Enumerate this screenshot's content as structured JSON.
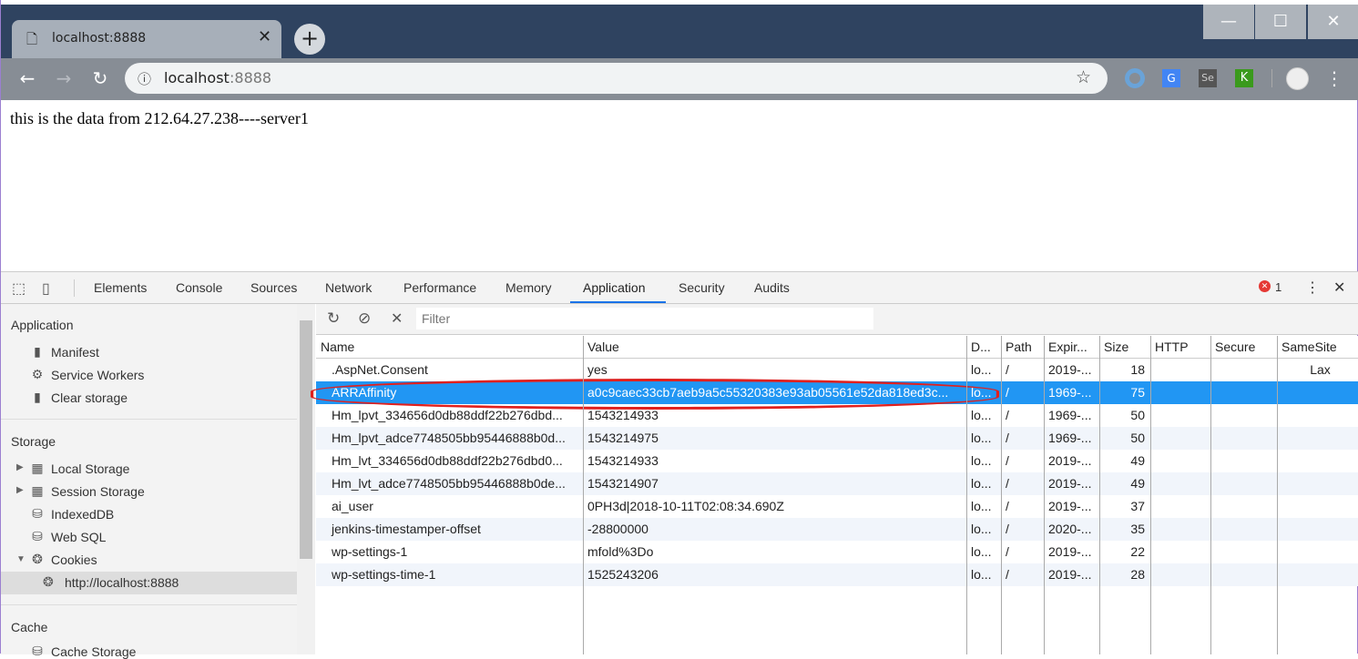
{
  "browser": {
    "tab_title": "localhost:8888",
    "url_host": "localhost",
    "url_port": ":8888",
    "window_controls": [
      "minimize",
      "maximize",
      "close"
    ]
  },
  "page": {
    "text": "this is the data from 212.64.27.238----server1"
  },
  "devtools": {
    "tabs": [
      "Elements",
      "Console",
      "Sources",
      "Network",
      "Performance",
      "Memory",
      "Application",
      "Security",
      "Audits"
    ],
    "active_tab": "Application",
    "error_count": "1",
    "filter_placeholder": "Filter",
    "sidebar": {
      "application_header": "Application",
      "application_items": [
        {
          "label": "Manifest",
          "icon": "file-icon"
        },
        {
          "label": "Service Workers",
          "icon": "gear-icon"
        },
        {
          "label": "Clear storage",
          "icon": "trash-icon"
        }
      ],
      "storage_header": "Storage",
      "storage_items": [
        {
          "label": "Local Storage",
          "icon": "grid-icon"
        },
        {
          "label": "Session Storage",
          "icon": "grid-icon"
        },
        {
          "label": "IndexedDB",
          "icon": "database-icon"
        },
        {
          "label": "Web SQL",
          "icon": "database-icon"
        },
        {
          "label": "Cookies",
          "icon": "cookie-icon"
        }
      ],
      "cookie_origin": "http://localhost:8888",
      "cache_header": "Cache",
      "cache_items": [
        {
          "label": "Cache Storage"
        }
      ]
    },
    "columns": [
      "Name",
      "Value",
      "D...",
      "Path",
      "Expir...",
      "Size",
      "HTTP",
      "Secure",
      "SameSite"
    ],
    "rows": [
      [
        ".AspNet.Consent",
        "yes",
        "lo...",
        "/",
        "2019-...",
        "18",
        "",
        "",
        "Lax"
      ],
      [
        "ARRAffinity",
        "a0c9caec33cb7aeb9a5c55320383e93ab05561e52da818ed3c...",
        "lo...",
        "/",
        "1969-...",
        "75",
        "",
        "",
        ""
      ],
      [
        "Hm_lpvt_334656d0db88ddf22b276dbd...",
        "1543214933",
        "lo...",
        "/",
        "1969-...",
        "50",
        "",
        "",
        ""
      ],
      [
        "Hm_lpvt_adce7748505bb95446888b0d...",
        "1543214975",
        "lo...",
        "/",
        "1969-...",
        "50",
        "",
        "",
        ""
      ],
      [
        "Hm_lvt_334656d0db88ddf22b276dbd0...",
        "1543214933",
        "lo...",
        "/",
        "2019-...",
        "49",
        "",
        "",
        ""
      ],
      [
        "Hm_lvt_adce7748505bb95446888b0de...",
        "1543214907",
        "lo...",
        "/",
        "2019-...",
        "49",
        "",
        "",
        ""
      ],
      [
        "ai_user",
        "0PH3d|2018-10-11T02:08:34.690Z",
        "lo...",
        "/",
        "2019-...",
        "37",
        "",
        "",
        ""
      ],
      [
        "jenkins-timestamper-offset",
        "-28800000",
        "lo...",
        "/",
        "2020-...",
        "35",
        "",
        "",
        ""
      ],
      [
        "wp-settings-1",
        "mfold%3Do",
        "lo...",
        "/",
        "2019-...",
        "22",
        "",
        "",
        ""
      ],
      [
        "wp-settings-time-1",
        "1525243206",
        "lo...",
        "/",
        "2019-...",
        "28",
        "",
        "",
        ""
      ]
    ],
    "selected_row": 1,
    "colors": {
      "accent": "#1a73e8",
      "selected": "#2196f3",
      "highlight_circle": "#e0201e"
    }
  }
}
